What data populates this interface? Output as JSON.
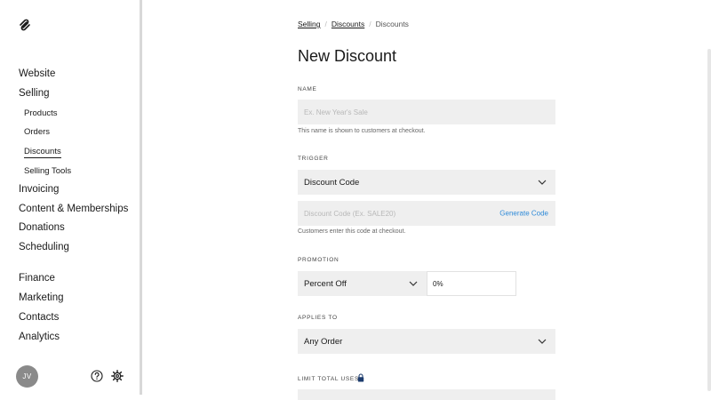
{
  "sidebar": {
    "items": [
      {
        "label": "Website"
      },
      {
        "label": "Selling"
      },
      {
        "label": "Invoicing"
      },
      {
        "label": "Content & Memberships"
      },
      {
        "label": "Donations"
      },
      {
        "label": "Scheduling"
      },
      {
        "label": "Finance"
      },
      {
        "label": "Marketing"
      },
      {
        "label": "Contacts"
      },
      {
        "label": "Analytics"
      }
    ],
    "selling_sub": [
      {
        "label": "Products"
      },
      {
        "label": "Orders"
      },
      {
        "label": "Discounts",
        "active": true
      },
      {
        "label": "Selling Tools"
      }
    ],
    "avatar_initials": "JV"
  },
  "breadcrumb": {
    "items": [
      "Selling",
      "Discounts",
      "Discounts"
    ],
    "separator": "/"
  },
  "page": {
    "title": "New Discount"
  },
  "form": {
    "name": {
      "label": "NAME",
      "placeholder": "Ex. New Year's Sale",
      "help": "This name is shown to customers at checkout."
    },
    "trigger": {
      "label": "TRIGGER",
      "value": "Discount Code",
      "code_placeholder": "Discount Code (Ex. SALE20)",
      "generate_label": "Generate Code",
      "help": "Customers enter this code at checkout."
    },
    "promotion": {
      "label": "PROMOTION",
      "type": "Percent Off",
      "amount": "0%"
    },
    "applies_to": {
      "label": "APPLIES TO",
      "value": "Any Order"
    },
    "limit": {
      "label": "LIMIT TOTAL USES"
    }
  },
  "colors": {
    "accent_link": "#2e8ad8",
    "field_bg": "#efefef",
    "avatar_bg": "#8a8a8a"
  }
}
